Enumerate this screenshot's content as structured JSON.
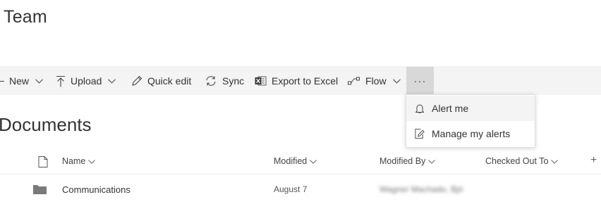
{
  "site": {
    "title": "Team"
  },
  "commandbar": {
    "new_label": "New",
    "upload_label": "Upload",
    "quick_edit_label": "Quick edit",
    "sync_label": "Sync",
    "export_label": "Export to Excel",
    "flow_label": "Flow",
    "more_label": "···"
  },
  "more_menu": {
    "items": [
      {
        "label": "Alert me",
        "icon": "bell-icon"
      },
      {
        "label": "Manage my alerts",
        "icon": "edit-alerts-icon"
      }
    ]
  },
  "library": {
    "title": "Documents"
  },
  "columns": {
    "name": "Name",
    "modified": "Modified",
    "modified_by": "Modified By",
    "checked_out_to": "Checked Out To",
    "add_column": "+"
  },
  "rows": [
    {
      "name": "Communications",
      "modified": "August 7",
      "modified_by": "Wagner Machado, Bjö"
    }
  ],
  "colors": {
    "commandbar_bg": "#f4f4f4",
    "more_active_bg": "#d8d8d8",
    "text": "#333333"
  }
}
